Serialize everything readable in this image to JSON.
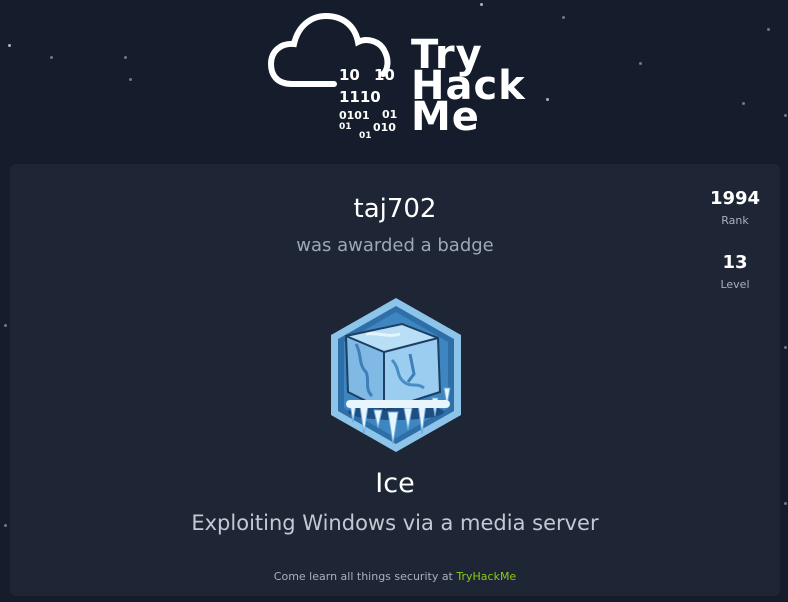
{
  "logo": {
    "binary_lines": [
      "10",
      "10",
      "1110",
      "0101",
      "01",
      "01",
      "010",
      "01"
    ],
    "brand_lines": [
      "Try",
      "Hack",
      "Me"
    ]
  },
  "card": {
    "username": "taj702",
    "subtitle": "was awarded a badge",
    "stats": [
      {
        "value": "1994",
        "label": "Rank"
      },
      {
        "value": "13",
        "label": "Level"
      }
    ],
    "badge": {
      "icon": "ice-cube-badge-icon",
      "name": "Ice",
      "description": "Exploiting Windows via a media server"
    },
    "footer": {
      "text": "Come learn all things security at",
      "link": "TryHackMe"
    }
  },
  "colors": {
    "background": "#151c2b",
    "card": "#1e2636",
    "accent": "#88cc14"
  }
}
